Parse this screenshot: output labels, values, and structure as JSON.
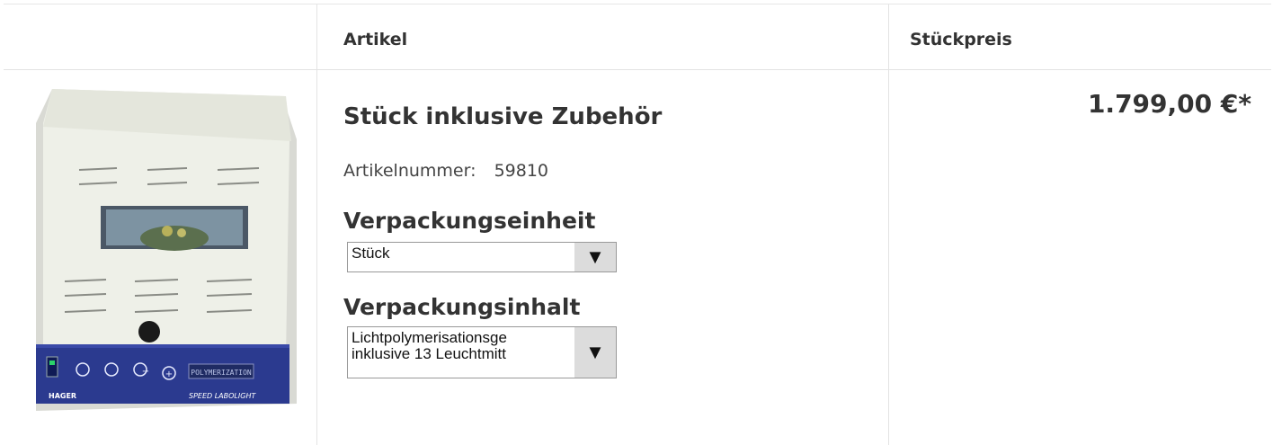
{
  "table": {
    "headers": {
      "article": "Artikel",
      "unit_price": "Stückpreis"
    }
  },
  "product": {
    "image_label_display": "POLYMERIZATION",
    "image_brand": "HAGER",
    "image_model": "SPEED LABOLIGHT",
    "title": "Stück inklusive Zubehör",
    "sku_label": "Artikelnummer:",
    "sku_value": "59810",
    "packaging_unit": {
      "heading": "Verpackungseinheit",
      "selected": "Stück"
    },
    "packaging_content": {
      "heading": "Verpackungsinhalt",
      "selected_line1": "Lichtpolymerisationsge",
      "selected_line2": "inklusive 13 Leuchtmitt"
    },
    "price": "1.799,00 €*"
  },
  "colors": {
    "panel_blue": "#2b3a8f",
    "device_body": "#eceee6"
  }
}
